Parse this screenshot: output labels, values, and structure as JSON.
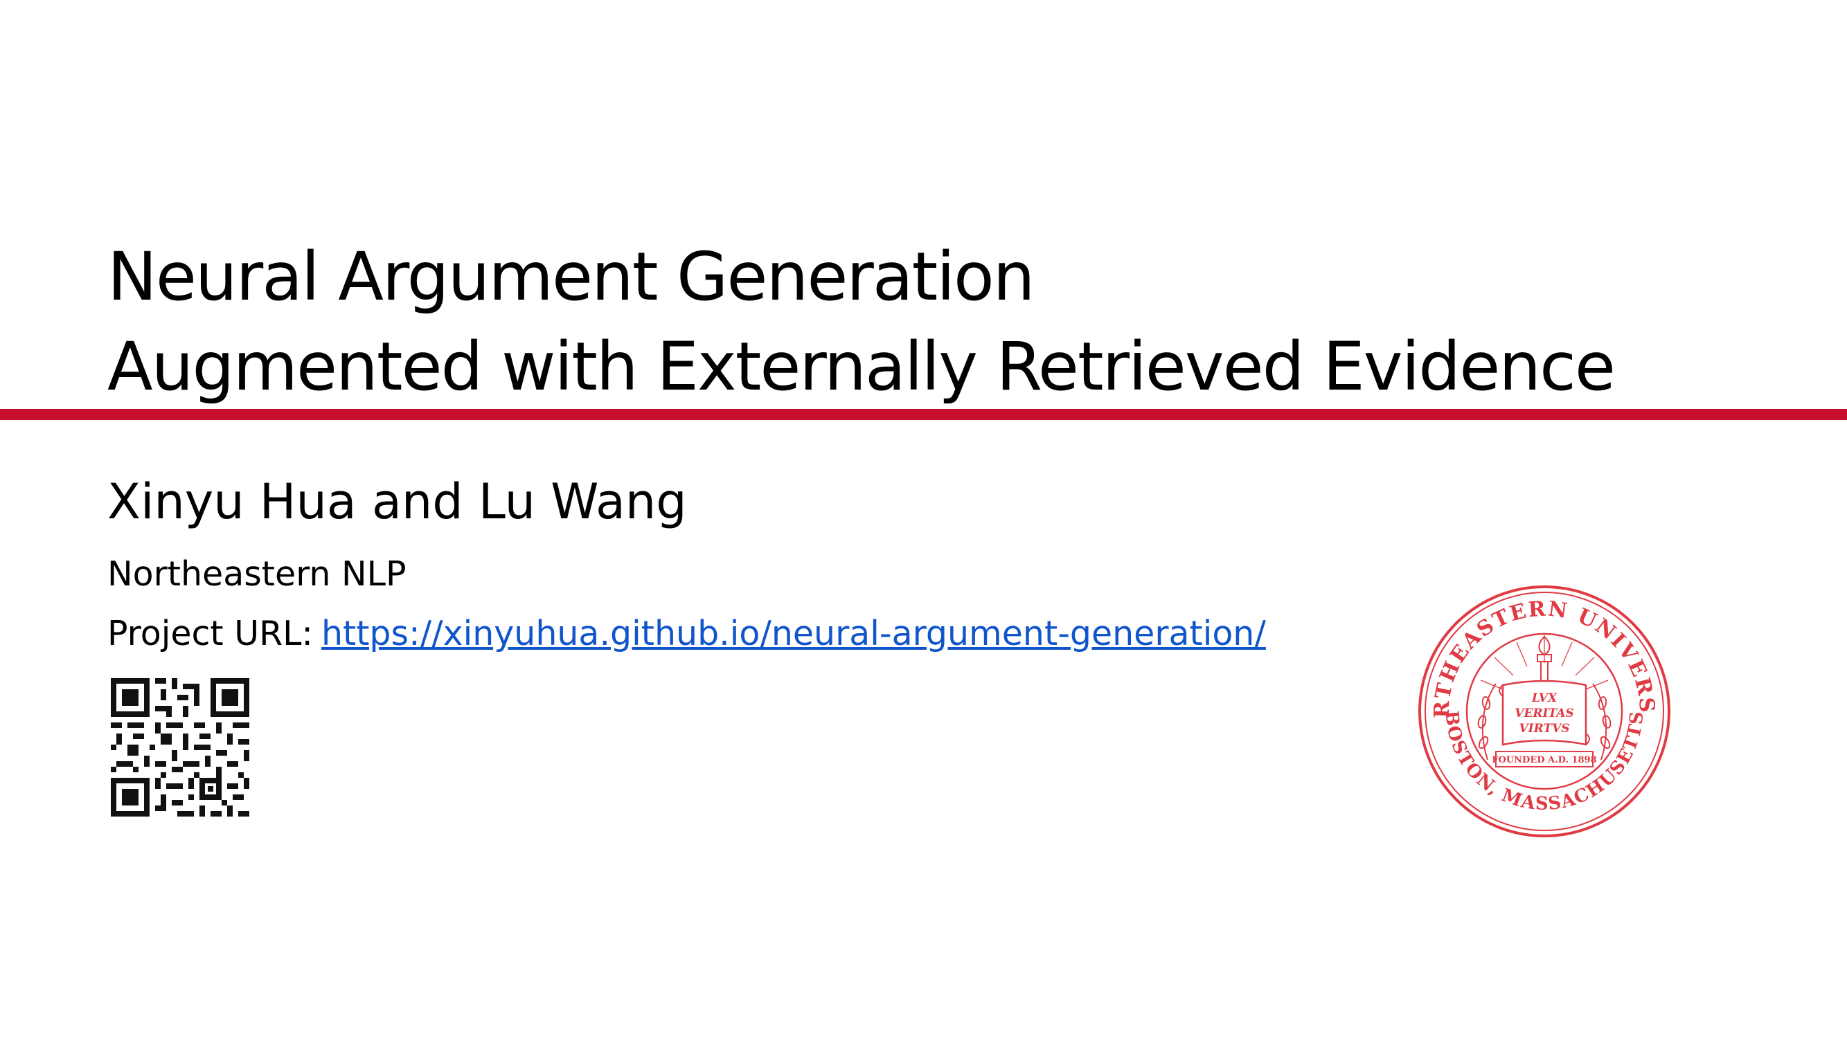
{
  "slide": {
    "title_lines": [
      "Neural Argument Generation",
      "Augmented with Externally Retrieved Evidence"
    ],
    "authors": "Xinyu Hua and Lu Wang",
    "affiliation": "Northeastern NLP",
    "project_url_label": "Project URL:",
    "project_url": "https://xinyuhua.github.io/neural-argument-generation/"
  },
  "seal": {
    "top_text": "NORTHEASTERN UNIVERSITY",
    "bottom_text": "BOSTON, MASSACHUSETTS",
    "motto_lines": [
      "LVX",
      "VERITAS",
      "VIRTVS"
    ],
    "founded_text": "FOUNDED A.D. 1898",
    "color": "#e03a44"
  },
  "colors": {
    "accent_rule": "#c8102e",
    "link": "#1155cc",
    "text": "#000000"
  },
  "qr": {
    "icon": "qr-code-icon"
  }
}
